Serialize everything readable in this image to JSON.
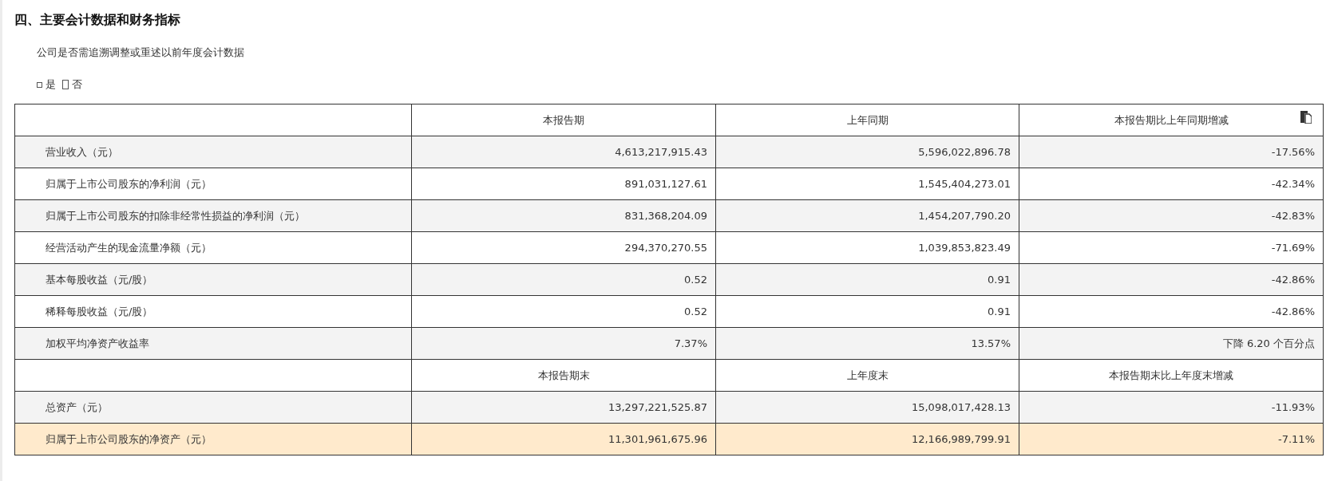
{
  "title": "四、主要会计数据和财务指标",
  "question": "公司是否需追溯调整或重述以前年度会计数据",
  "options": [
    {
      "label": "是",
      "checked": false
    },
    {
      "label": "否",
      "checked": true
    }
  ],
  "table": {
    "rows": [
      {
        "kind": "header",
        "cells": [
          "",
          "本报告期",
          "上年同期",
          "本报告期比上年同期增减"
        ]
      },
      {
        "kind": "data",
        "highlighted": false,
        "cells": [
          "营业收入（元）",
          "4,613,217,915.43",
          "5,596,022,896.78",
          "-17.56%"
        ]
      },
      {
        "kind": "data",
        "highlighted": false,
        "cells": [
          "归属于上市公司股东的净利润（元）",
          "891,031,127.61",
          "1,545,404,273.01",
          "-42.34%"
        ]
      },
      {
        "kind": "data",
        "highlighted": false,
        "cells": [
          "归属于上市公司股东的扣除非经常性损益的净利润（元）",
          "831,368,204.09",
          "1,454,207,790.20",
          "-42.83%"
        ]
      },
      {
        "kind": "data",
        "highlighted": false,
        "cells": [
          "经营活动产生的现金流量净额（元）",
          "294,370,270.55",
          "1,039,853,823.49",
          "-71.69%"
        ]
      },
      {
        "kind": "data",
        "highlighted": false,
        "cells": [
          "基本每股收益（元/股）",
          "0.52",
          "0.91",
          "-42.86%"
        ]
      },
      {
        "kind": "data",
        "highlighted": false,
        "cells": [
          "稀释每股收益（元/股）",
          "0.52",
          "0.91",
          "-42.86%"
        ]
      },
      {
        "kind": "data",
        "highlighted": false,
        "cells": [
          "加权平均净资产收益率",
          "7.37%",
          "13.57%",
          "下降 6.20 个百分点"
        ]
      },
      {
        "kind": "header",
        "cells": [
          "",
          "本报告期末",
          "上年度末",
          "本报告期末比上年度末增减"
        ]
      },
      {
        "kind": "data",
        "highlighted": false,
        "cells": [
          "总资产（元）",
          "13,297,221,525.87",
          "15,098,017,428.13",
          "-11.93%"
        ]
      },
      {
        "kind": "data",
        "highlighted": true,
        "cells": [
          "归属于上市公司股东的净资产（元）",
          "11,301,961,675.96",
          "12,166,989,799.91",
          "-7.11%"
        ]
      }
    ]
  }
}
